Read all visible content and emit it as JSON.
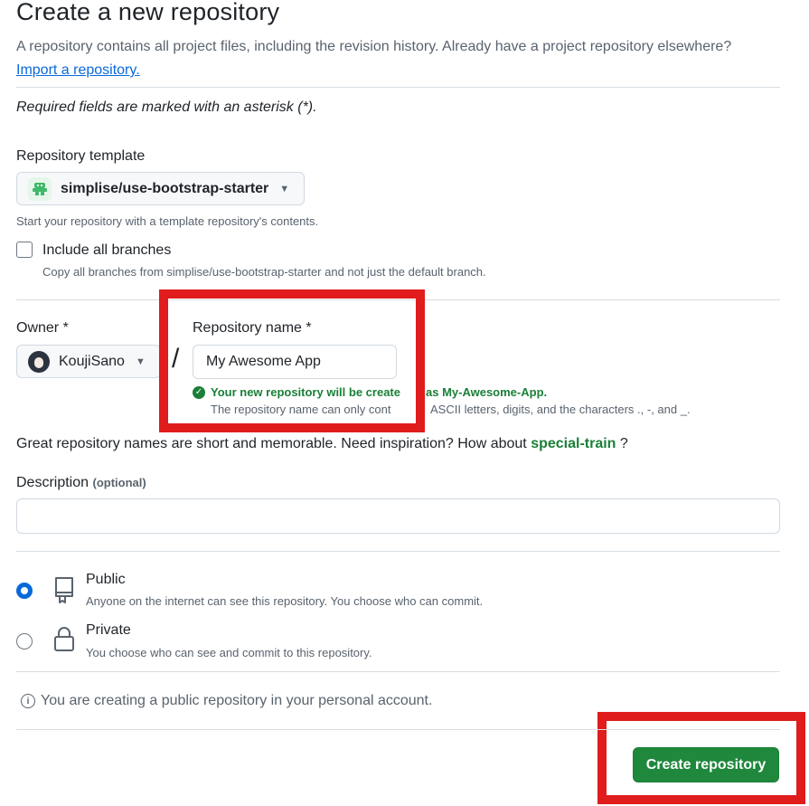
{
  "header": {
    "title": "Create a new repository",
    "subtitle": "A repository contains all project files, including the revision history. Already have a project repository elsewhere?",
    "import_link": "Import a repository."
  },
  "required_note": "Required fields are marked with an asterisk (*).",
  "template": {
    "label": "Repository template",
    "selected": "simplise/use-bootstrap-starter",
    "helper": "Start your repository with a template repository's contents.",
    "include_branches_label": "Include all branches",
    "include_branches_helper": "Copy all branches from simplise/use-bootstrap-starter and not just the default branch.",
    "include_branches_checked": false
  },
  "owner": {
    "label": "Owner *",
    "value": "KoujiSano"
  },
  "slash": "/",
  "repo_name": {
    "label": "Repository name *",
    "value": "My Awesome App",
    "success_prefix": "Your new repository will be create",
    "success_suffix": "as My-Awesome-App.",
    "rules_prefix": "The repository name can only cont",
    "rules_suffix": "ASCII letters, digits, and the characters .,  -, and _."
  },
  "inspiration": {
    "text": "Great repository names are short and memorable. Need inspiration? How about",
    "suggestion": "special-train",
    "end": "?"
  },
  "description": {
    "label": "Description",
    "optional": "(optional)",
    "value": ""
  },
  "visibility": {
    "selected": "Public",
    "options": [
      {
        "title": "Public",
        "desc": "Anyone on the internet can see this repository. You choose who can commit."
      },
      {
        "title": "Private",
        "desc": "You choose who can see and commit to this repository."
      }
    ]
  },
  "notice": "You are creating a public repository in your personal account.",
  "create_button": "Create repository",
  "colors": {
    "primary_button": "#1f883d",
    "link": "#0969da",
    "success": "#1a7f37",
    "highlight": "#e01c1c"
  }
}
